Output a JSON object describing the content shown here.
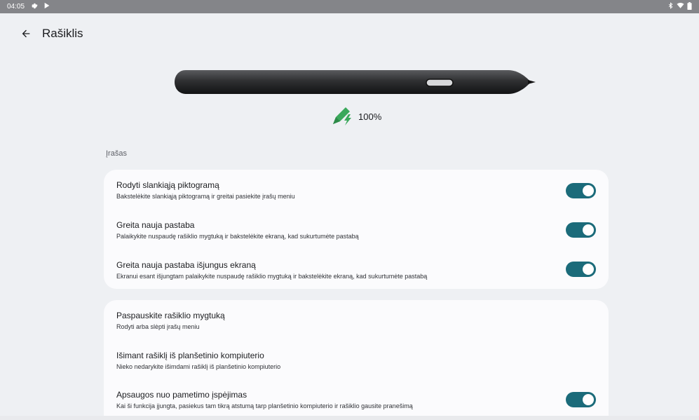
{
  "status_bar": {
    "time": "04:05",
    "icons": [
      "settings-icon",
      "play-store-icon",
      "bluetooth-icon",
      "wifi-icon",
      "battery-icon"
    ]
  },
  "app_bar": {
    "title": "Rašiklis",
    "back_icon": "arrow-back-icon"
  },
  "pen": {
    "battery_percent": "100%",
    "battery_icon": "pen-charging-icon",
    "accent_color": "#3aa85b"
  },
  "sections": [
    {
      "header": "Įrašas",
      "items": [
        {
          "title": "Rodyti slankiąją piktogramą",
          "summary": "Bakstelėkite slankiąją piktogramą ir greitai pasiekite įrašų meniu",
          "toggle": true
        },
        {
          "title": "Greita nauja pastaba",
          "summary": "Palaikykite nuspaudę rašiklio mygtuką ir bakstelėkite ekraną, kad sukurtumėte pastabą",
          "toggle": true
        },
        {
          "title": "Greita nauja pastaba išjungus ekraną",
          "summary": "Ekranui esant išjungtam palaikykite nuspaudę rašiklio mygtuką ir bakstelėkite ekraną, kad sukurtumėte pastabą",
          "toggle": true
        }
      ]
    },
    {
      "items": [
        {
          "title": "Paspauskite rašiklio mygtuką",
          "summary": "Rodyti arba slėpti įrašų meniu"
        },
        {
          "title": "Išimant rašiklį iš planšetinio kompiuterio",
          "summary": "Nieko nedarykite išimdami rašiklį iš planšetinio kompiuterio"
        },
        {
          "title": "Apsaugos nuo pametimo įspėjimas",
          "summary": "Kai ši funkcija įjungta, pasiekus tam tikrą atstumą tarp planšetinio kompiuterio ir rašiklio gausite pranešimą",
          "toggle": true
        }
      ]
    }
  ],
  "colors": {
    "background": "#eef0f3",
    "card": "#fbfbfd",
    "toggle_on": "#1b6b7a",
    "status_bar": "#848589"
  }
}
